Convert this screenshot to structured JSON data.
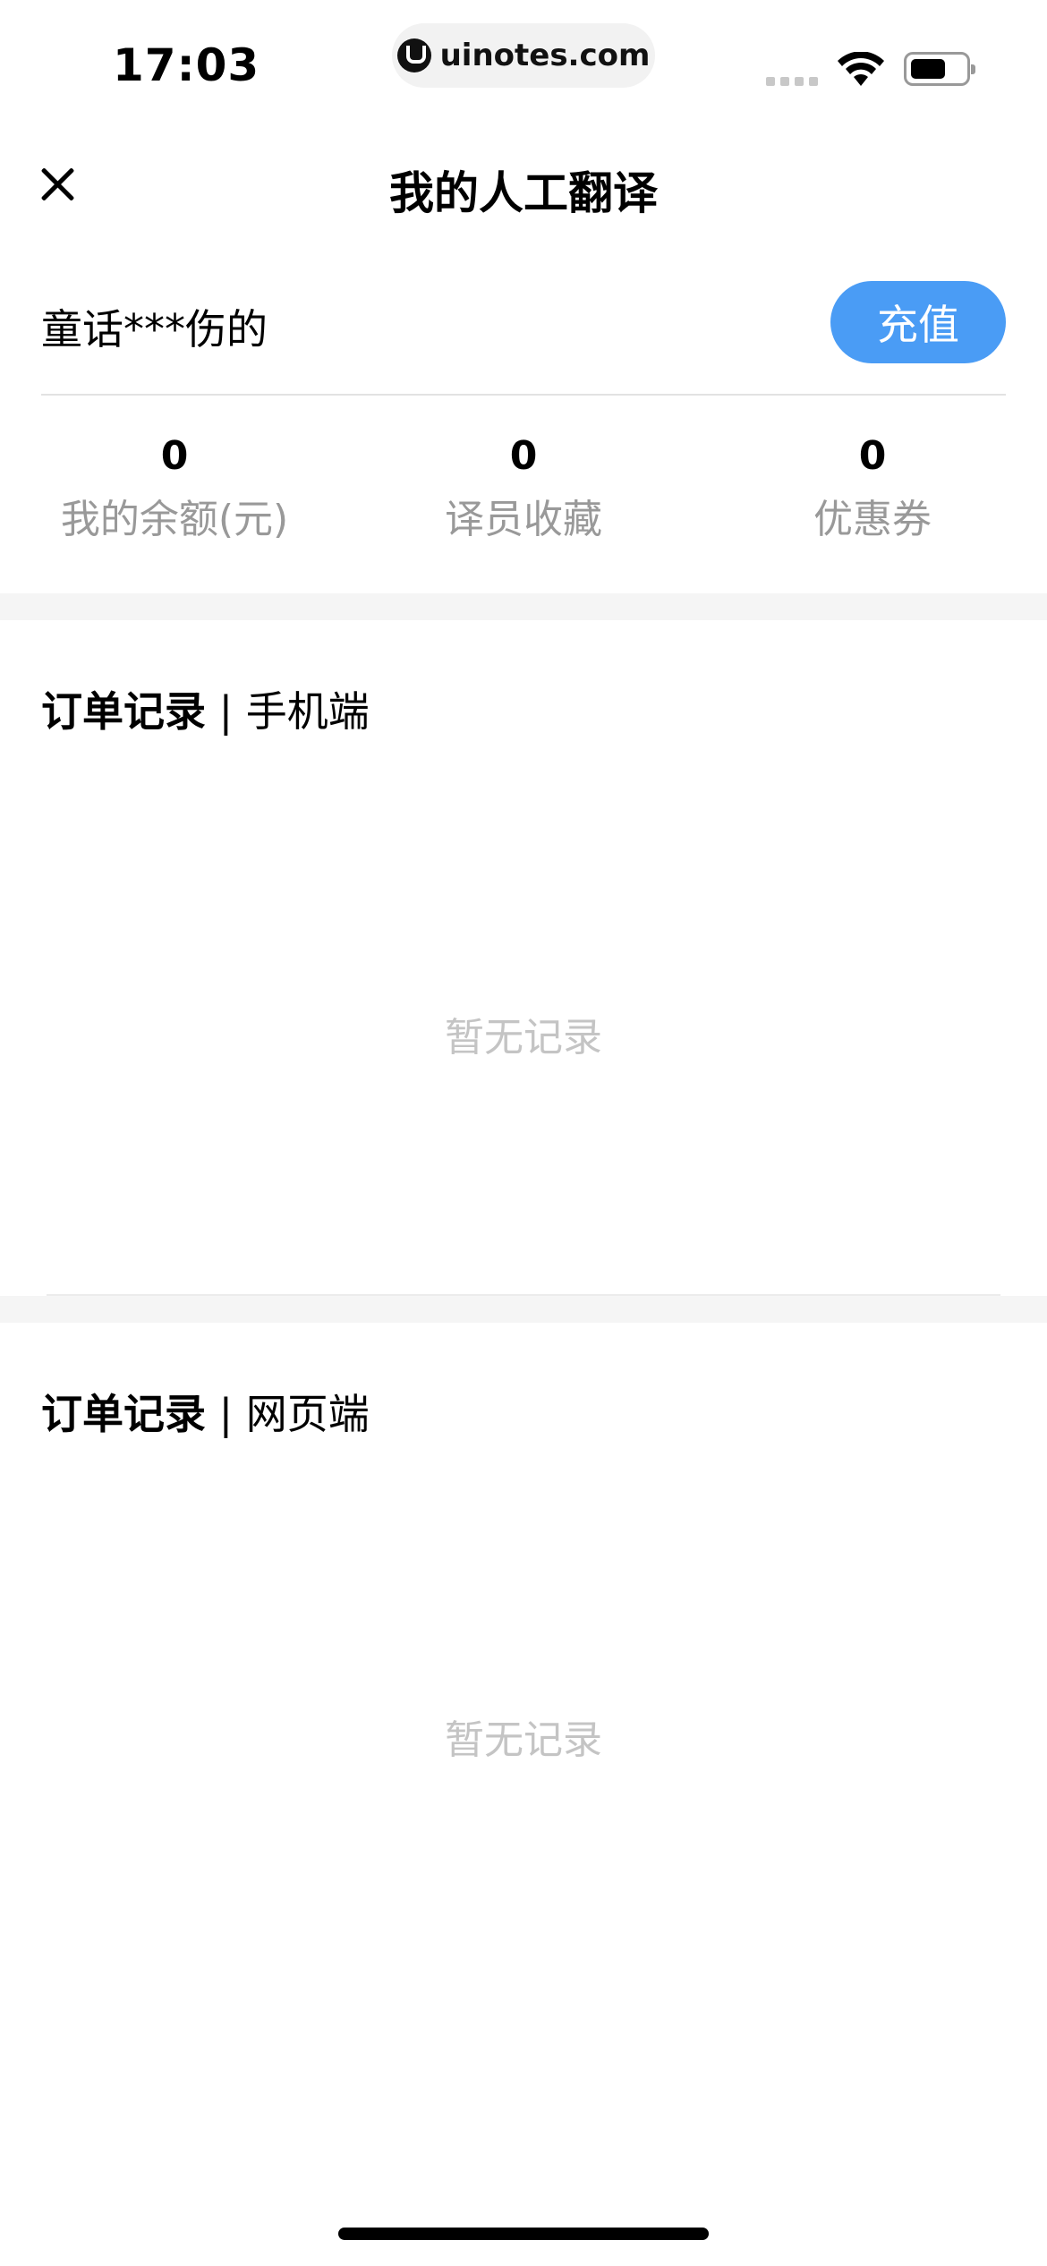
{
  "status_bar": {
    "time": "17:03",
    "url": "uinotes.com"
  },
  "header": {
    "title": "我的人工翻译"
  },
  "user": {
    "name": "童话***伤的",
    "recharge_label": "充值",
    "accent_color": "#4a9cf5"
  },
  "stats": [
    {
      "value": "0",
      "label": "我的余额(元)"
    },
    {
      "value": "0",
      "label": "译员收藏"
    },
    {
      "value": "0",
      "label": "优惠券"
    }
  ],
  "sections": [
    {
      "title_bold": "订单记录",
      "title_sep": " | ",
      "title_rest": "手机端",
      "empty": "暂无记录"
    },
    {
      "title_bold": "订单记录",
      "title_sep": " | ",
      "title_rest": "网页端",
      "empty": "暂无记录"
    }
  ]
}
